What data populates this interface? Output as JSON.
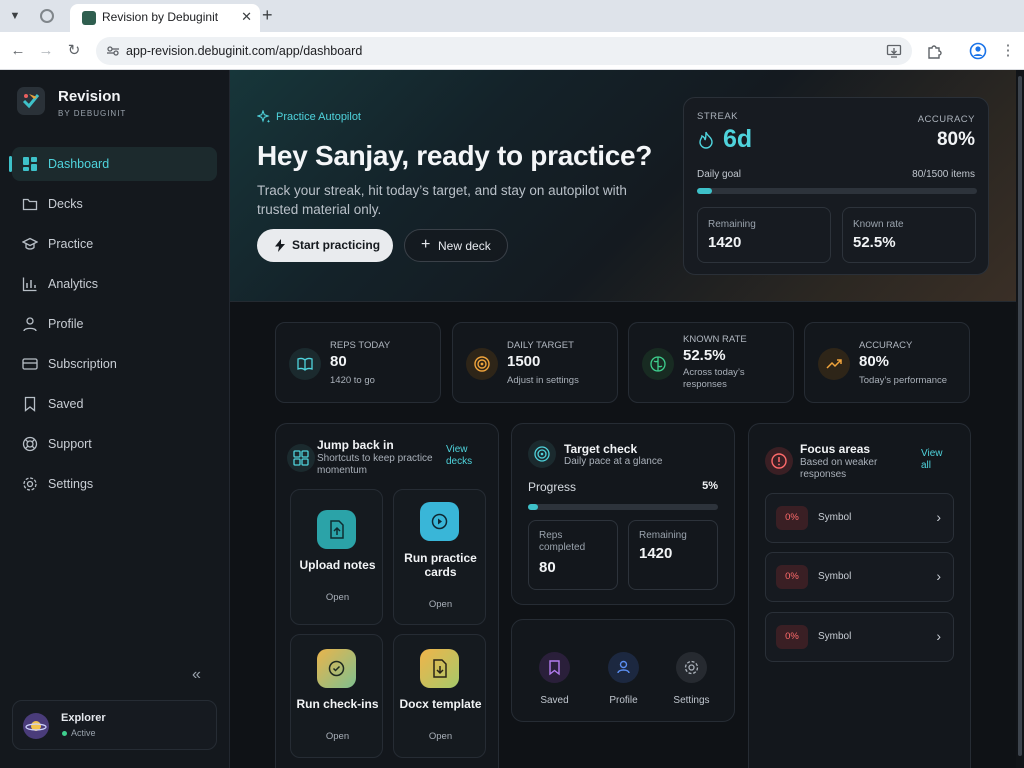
{
  "browser": {
    "tab_title": "Revision by Debuginit",
    "url": "app-revision.debuginit.com/app/dashboard"
  },
  "sidebar": {
    "brand_name": "Revision",
    "brand_sub": "BY DEBUGINIT",
    "items": [
      {
        "label": "Dashboard",
        "icon": "dashboard-icon",
        "active": true
      },
      {
        "label": "Decks",
        "icon": "folder-icon"
      },
      {
        "label": "Practice",
        "icon": "graduation-cap-icon"
      },
      {
        "label": "Analytics",
        "icon": "bar-chart-icon"
      },
      {
        "label": "Profile",
        "icon": "user-icon"
      },
      {
        "label": "Subscription",
        "icon": "credit-card-icon"
      },
      {
        "label": "Saved",
        "icon": "bookmark-icon"
      },
      {
        "label": "Support",
        "icon": "lifebuoy-icon"
      },
      {
        "label": "Settings",
        "icon": "gear-icon"
      }
    ],
    "user": {
      "name": "Explorer",
      "status": "Active"
    }
  },
  "hero": {
    "eyebrow": "Practice Autopilot",
    "title": "Hey Sanjay, ready to practice?",
    "subtitle": "Track your streak, hit today’s target, and stay on autopilot with trusted material only.",
    "start_label": "Start practicing",
    "new_deck_label": "New deck"
  },
  "streak_card": {
    "streak_label": "STREAK",
    "streak_value": "6d",
    "accuracy_label": "ACCURACY",
    "accuracy_value": "80%",
    "goal_label": "Daily goal",
    "goal_value": "80/1500 items",
    "goal_progress": 0.053,
    "remaining_label": "Remaining",
    "remaining_value": "1420",
    "known_label": "Known rate",
    "known_value": "52.5%"
  },
  "stats": [
    {
      "label": "REPS TODAY",
      "value": "80",
      "sub": "1420 to go"
    },
    {
      "label": "DAILY TARGET",
      "value": "1500",
      "sub": "Adjust in settings"
    },
    {
      "label": "KNOWN RATE",
      "value": "52.5%",
      "sub": "Across today’s responses"
    },
    {
      "label": "ACCURACY",
      "value": "80%",
      "sub": "Today’s performance"
    }
  ],
  "jump_back": {
    "title": "Jump back in",
    "subtitle": "Shortcuts to keep practice momentum",
    "link": "View decks",
    "tiles": [
      {
        "title": "Upload notes",
        "open": "Open"
      },
      {
        "title": "Run practice cards",
        "open": "Open"
      },
      {
        "title": "Run check-ins",
        "open": "Open"
      },
      {
        "title": "Docx template",
        "open": "Open"
      }
    ]
  },
  "target_check": {
    "title": "Target check",
    "subtitle": "Daily pace at a glance",
    "progress_label": "Progress",
    "progress_value": "5%",
    "progress": 0.05,
    "reps_label": "Reps completed",
    "reps_value": "80",
    "remaining_label": "Remaining",
    "remaining_value": "1420"
  },
  "quick_links": [
    {
      "label": "Saved"
    },
    {
      "label": "Profile"
    },
    {
      "label": "Settings"
    }
  ],
  "focus": {
    "title": "Focus areas",
    "subtitle": "Based on weaker responses",
    "link": "View all",
    "rows": [
      {
        "pct": "0%",
        "name": "Symbol"
      },
      {
        "pct": "0%",
        "name": "Symbol"
      },
      {
        "pct": "0%",
        "name": "Symbol"
      }
    ]
  },
  "colors": {
    "accent": "#3ec1c9",
    "background": "#0f1216",
    "danger": "#ff6b6b"
  }
}
